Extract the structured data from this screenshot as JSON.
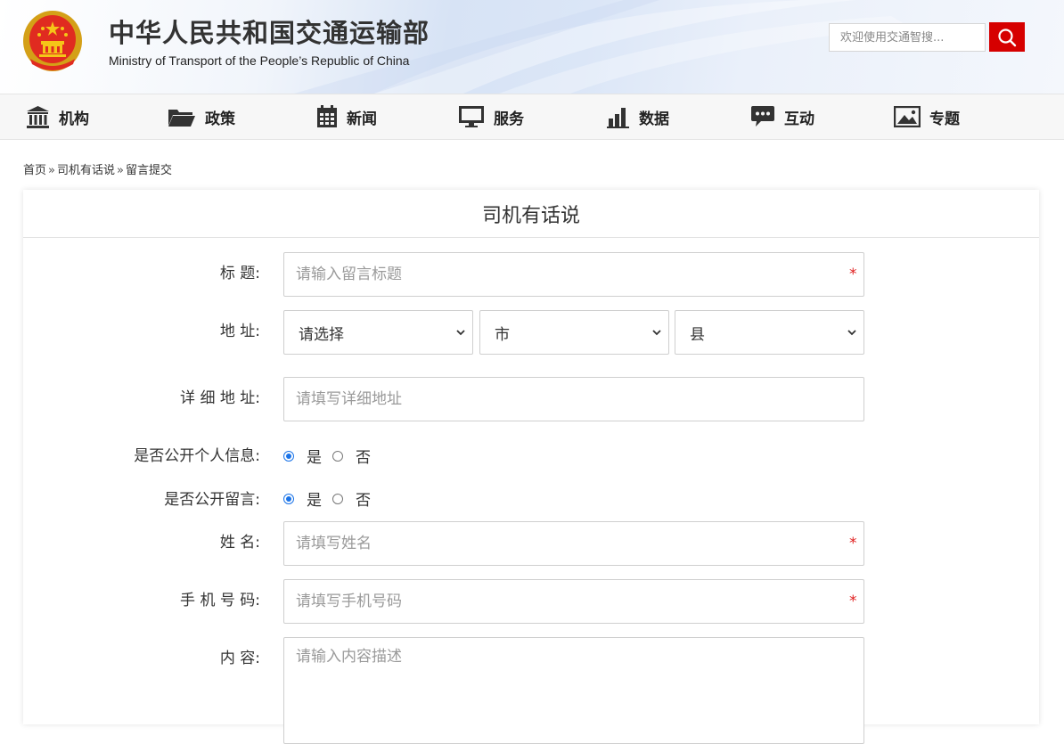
{
  "header": {
    "title": "中华人民共和国交通运输部",
    "subtitle": "Ministry of Transport of the People’s Republic of China",
    "search_placeholder": "欢迎使用交通智搜..."
  },
  "nav": {
    "items": [
      {
        "label": "机构",
        "icon": "institution-icon"
      },
      {
        "label": "政策",
        "icon": "folder-icon"
      },
      {
        "label": "新闻",
        "icon": "calendar-icon"
      },
      {
        "label": "服务",
        "icon": "monitor-icon"
      },
      {
        "label": "数据",
        "icon": "bar-chart-icon"
      },
      {
        "label": "互动",
        "icon": "chat-icon"
      },
      {
        "label": "专题",
        "icon": "image-icon"
      }
    ]
  },
  "breadcrumb": [
    "首页",
    "司机有话说",
    "留言提交"
  ],
  "form": {
    "title": "司机有话说",
    "title_field": {
      "label": "标 题:",
      "placeholder": "请输入留言标题"
    },
    "address": {
      "label": "地 址:",
      "province": "请选择",
      "city": "市",
      "county": "县"
    },
    "detail_address": {
      "label": "详 细 地 址:",
      "placeholder": "请填写详细地址"
    },
    "public_info": {
      "label": "是否公开个人信息:",
      "yes": "是",
      "no": "否",
      "selected": "是"
    },
    "public_message": {
      "label": "是否公开留言:",
      "yes": "是",
      "no": "否",
      "selected": "是"
    },
    "name": {
      "label": "姓 名:",
      "placeholder": "请填写姓名"
    },
    "phone": {
      "label": "手 机 号 码:",
      "placeholder": "请填写手机号码"
    },
    "content": {
      "label": "内 容:",
      "placeholder": "请输入内容描述"
    },
    "required_mark": "*"
  },
  "colors": {
    "accent_red": "#d60000",
    "radio_blue": "#1a73e8",
    "required_red": "#e02020"
  }
}
